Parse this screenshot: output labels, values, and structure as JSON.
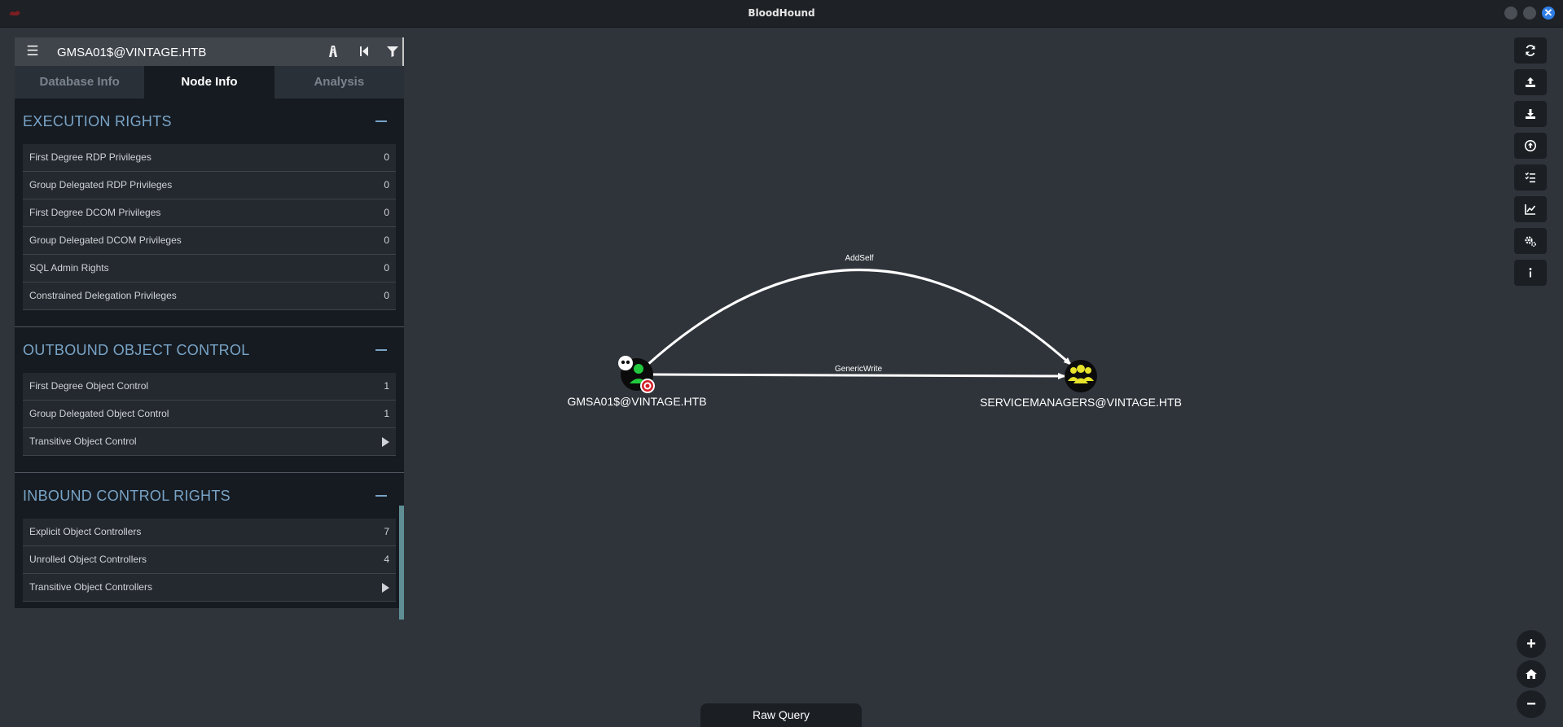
{
  "window": {
    "title": "BloodHound"
  },
  "search": {
    "value": "GMSA01$@VINTAGE.HTB"
  },
  "tabs": [
    {
      "label": "Database Info"
    },
    {
      "label": "Node Info"
    },
    {
      "label": "Analysis"
    }
  ],
  "sections": {
    "execution": {
      "title": "EXECUTION RIGHTS",
      "rows": [
        {
          "label": "First Degree RDP Privileges",
          "value": "0"
        },
        {
          "label": "Group Delegated RDP Privileges",
          "value": "0"
        },
        {
          "label": "First Degree DCOM Privileges",
          "value": "0"
        },
        {
          "label": "Group Delegated DCOM Privileges",
          "value": "0"
        },
        {
          "label": "SQL Admin Rights",
          "value": "0"
        },
        {
          "label": "Constrained Delegation Privileges",
          "value": "0"
        }
      ]
    },
    "outbound": {
      "title": "OUTBOUND OBJECT CONTROL",
      "rows": [
        {
          "label": "First Degree Object Control",
          "value": "1"
        },
        {
          "label": "Group Delegated Object Control",
          "value": "1"
        },
        {
          "label": "Transitive Object Control",
          "value": ""
        }
      ]
    },
    "inbound": {
      "title": "INBOUND CONTROL RIGHTS",
      "rows": [
        {
          "label": "Explicit Object Controllers",
          "value": "7"
        },
        {
          "label": "Unrolled Object Controllers",
          "value": "4"
        },
        {
          "label": "Transitive Object Controllers",
          "value": ""
        }
      ]
    }
  },
  "graph": {
    "nodes": [
      {
        "label": "GMSA01$@VINTAGE.HTB",
        "type": "user",
        "color": "#22c93d"
      },
      {
        "label": "SERVICEMANAGERS@VINTAGE.HTB",
        "type": "group",
        "color": "#e6e22b"
      }
    ],
    "edges": [
      {
        "label": "AddSelf"
      },
      {
        "label": "GenericWrite"
      }
    ]
  },
  "toolbar": {
    "icons": [
      "refresh-icon",
      "upload-icon",
      "download-icon",
      "import-icon",
      "tasks-icon",
      "chart-icon",
      "settings-icon",
      "info-icon"
    ]
  },
  "zoom": {
    "in": "+",
    "out": "−"
  },
  "raw_query": {
    "label": "Raw Query"
  },
  "colors": {
    "accent": "#79a4c7",
    "close": "#2f7ee6",
    "panel": "#161b21",
    "canvas": "#2f343b"
  }
}
